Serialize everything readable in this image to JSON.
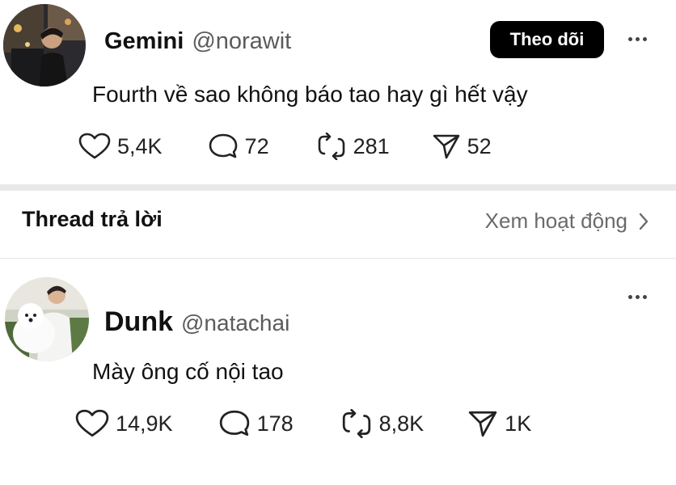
{
  "top_post": {
    "display_name": "Gemini",
    "handle": "@norawit",
    "follow_label": "Theo dõi",
    "text": "Fourth về sao không báo tao hay gì hết vậy",
    "likes": "5,4K",
    "comments": "72",
    "reposts": "281",
    "shares": "52"
  },
  "thread": {
    "title": "Thread trả lời",
    "view_activity": "Xem hoạt động"
  },
  "reply_post": {
    "display_name": "Dunk",
    "handle": "@natachai",
    "text": "Mày ông cố nội tao",
    "likes": "14,9K",
    "comments": "178",
    "reposts": "8,8K",
    "shares": "1K"
  },
  "colors": {
    "follow_bg": "#000000",
    "handle": "#5b5b5b",
    "separator": "#e9e9e9"
  }
}
